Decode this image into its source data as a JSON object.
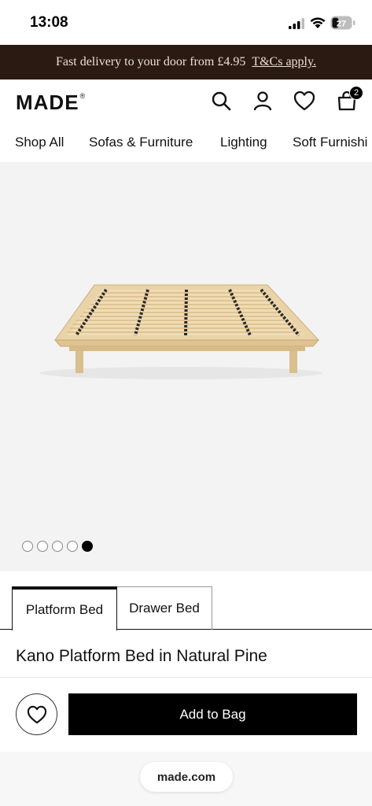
{
  "status_bar": {
    "time": "13:08",
    "battery": "27"
  },
  "promo": {
    "text": "Fast delivery to your door from £4.95",
    "link": "T&Cs apply."
  },
  "header": {
    "logo": "MADE",
    "logo_mark": "®",
    "bag_count": "2"
  },
  "categories": [
    "Shop All",
    "Sofas & Furniture",
    "Lighting",
    "Soft Furnishi"
  ],
  "gallery": {
    "total_images": 5,
    "active_index": 4
  },
  "tabs": [
    {
      "label": "Platform Bed",
      "selected": true
    },
    {
      "label": "Drawer Bed",
      "selected": false
    }
  ],
  "product": {
    "title": "Kano Platform Bed in Natural Pine"
  },
  "actions": {
    "add_to_bag": "Add to Bag"
  },
  "browser": {
    "url": "made.com"
  },
  "colors": {
    "promo_bg": "#2a1a12",
    "button_bg": "#000000",
    "image_bg": "#f3f3f3"
  }
}
